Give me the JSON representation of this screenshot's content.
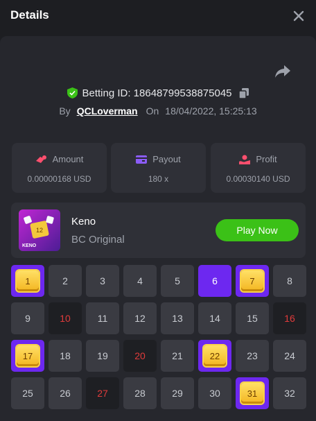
{
  "header": {
    "title": "Details"
  },
  "bet": {
    "betting_id": "Betting ID: 1864879953887504​5",
    "by_label": "By",
    "user": "QCLoverman",
    "on_label": "On",
    "datetime": "18/04/2022, 15:25:13"
  },
  "stats": [
    {
      "label": "Amount",
      "value": "0.00000168 USD",
      "icon": "coins-icon",
      "color": "#ff4f6e"
    },
    {
      "label": "Payout",
      "value": "180 x",
      "icon": "card-icon",
      "color": "#8b5cf6"
    },
    {
      "label": "Profit",
      "value": "0.00030140 USD",
      "icon": "profit-icon",
      "color": "#ff4f6e"
    }
  ],
  "game": {
    "name": "Keno",
    "subtitle": "BC Original",
    "play_label": "Play Now",
    "thumb_label": "KENO"
  },
  "colors": {
    "accent_green": "#3bc117",
    "purple": "#6d28f0",
    "miss_red": "#e03b3b",
    "gem_gold": "#f3b520"
  },
  "board": {
    "cells": [
      {
        "n": "1",
        "s": "hit"
      },
      {
        "n": "2",
        "s": ""
      },
      {
        "n": "3",
        "s": ""
      },
      {
        "n": "4",
        "s": ""
      },
      {
        "n": "5",
        "s": ""
      },
      {
        "n": "6",
        "s": "picked"
      },
      {
        "n": "7",
        "s": "hit"
      },
      {
        "n": "8",
        "s": ""
      },
      {
        "n": "9",
        "s": ""
      },
      {
        "n": "10",
        "s": "drawn"
      },
      {
        "n": "11",
        "s": ""
      },
      {
        "n": "12",
        "s": ""
      },
      {
        "n": "13",
        "s": ""
      },
      {
        "n": "14",
        "s": ""
      },
      {
        "n": "15",
        "s": ""
      },
      {
        "n": "16",
        "s": "drawn"
      },
      {
        "n": "17",
        "s": "hit"
      },
      {
        "n": "18",
        "s": ""
      },
      {
        "n": "19",
        "s": ""
      },
      {
        "n": "20",
        "s": "drawn"
      },
      {
        "n": "21",
        "s": ""
      },
      {
        "n": "22",
        "s": "hit"
      },
      {
        "n": "23",
        "s": ""
      },
      {
        "n": "24",
        "s": ""
      },
      {
        "n": "25",
        "s": ""
      },
      {
        "n": "26",
        "s": ""
      },
      {
        "n": "27",
        "s": "drawn"
      },
      {
        "n": "28",
        "s": ""
      },
      {
        "n": "29",
        "s": ""
      },
      {
        "n": "30",
        "s": ""
      },
      {
        "n": "31",
        "s": "hit"
      },
      {
        "n": "32",
        "s": ""
      }
    ]
  }
}
